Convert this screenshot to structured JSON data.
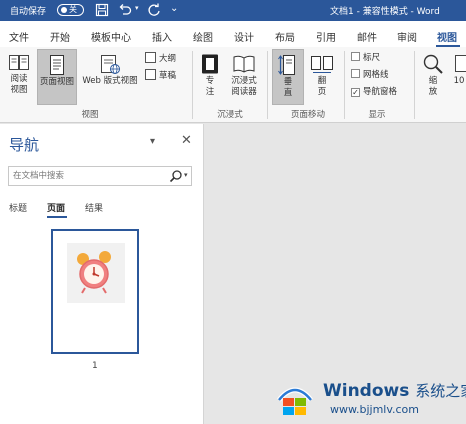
{
  "titlebar": {
    "autosave_label": "自动保存",
    "autosave_state": "关",
    "doc_title": "文档1 - 兼容性模式 - Word"
  },
  "tabs": [
    "文件",
    "开始",
    "模板中心",
    "插入",
    "绘图",
    "设计",
    "布局",
    "引用",
    "邮件",
    "审阅",
    "视图"
  ],
  "active_tab": "视图",
  "ribbon": {
    "views": {
      "read_mode": "阅读\n视图",
      "print_layout": "页面视图",
      "web_layout": "Web 版式视图",
      "outline": "大纲",
      "draft": "草稿",
      "group_label": "视图"
    },
    "immersive": {
      "focus": "专\n注",
      "immersive_reader": "沉浸式\n阅读器",
      "group_label": "沉浸式"
    },
    "page_movement": {
      "vertical": "垂\n直",
      "side_to_side": "翻\n页",
      "group_label": "页面移动"
    },
    "show": {
      "ruler": "标尺",
      "ruler_checked": false,
      "gridlines": "网格线",
      "gridlines_checked": false,
      "nav_pane": "导航窗格",
      "nav_pane_checked": true,
      "group_label": "显示"
    },
    "zoom": {
      "zoom": "缩\n放",
      "hundred": "10"
    }
  },
  "nav": {
    "title": "导航",
    "search_placeholder": "在文档中搜索",
    "tabs": [
      "标题",
      "页面",
      "结果"
    ],
    "active_tab": "页面",
    "page_number": "1"
  },
  "watermark": {
    "brand": "Windows",
    "brand_suffix": "系统之家",
    "url": "www.bjjmlv.com"
  }
}
